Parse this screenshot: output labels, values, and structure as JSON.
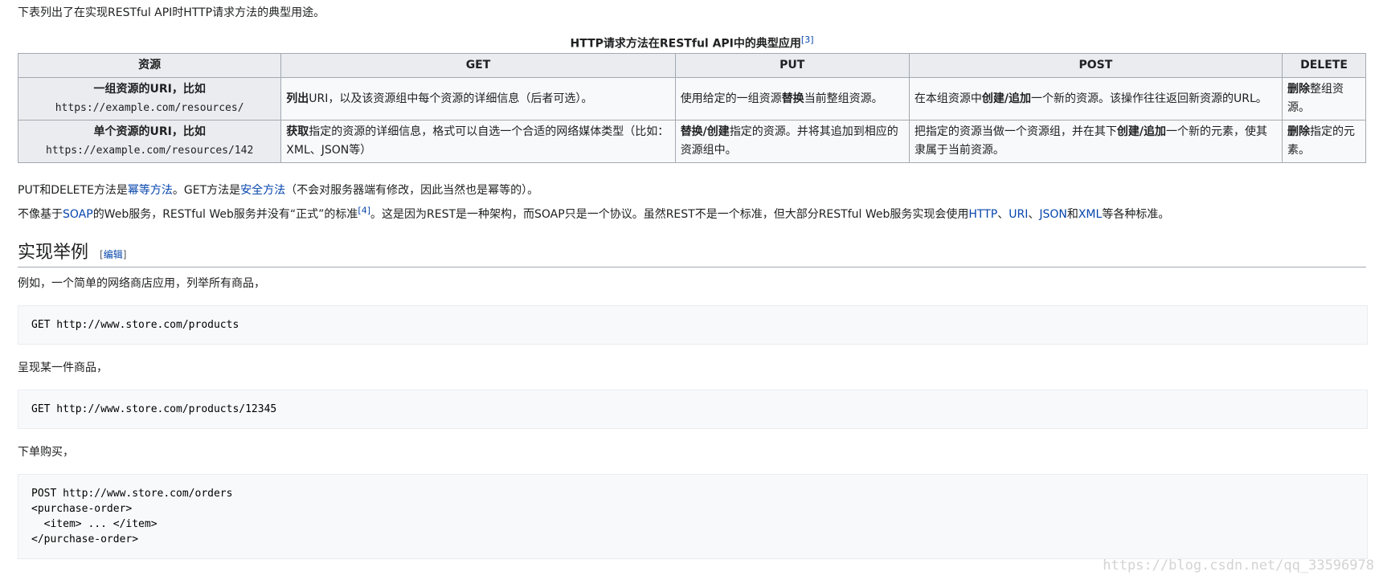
{
  "intro": "下表列出了在实现RESTful API时HTTP请求方法的典型用途。",
  "table": {
    "caption": "HTTP请求方法在RESTful API中的典型应用",
    "caption_ref": "[3]",
    "headers": [
      "资源",
      "GET",
      "PUT",
      "POST",
      "DELETE"
    ],
    "rows": [
      {
        "resource_label": "一组资源的URI，比如",
        "resource_uri": "https://example.com/resources/",
        "get": {
          "bold": "列出",
          "rest": "URI，以及该资源组中每个资源的详细信息（后者可选）。"
        },
        "put": {
          "pre": "使用给定的一组资源",
          "bold": "替换",
          "post": "当前整组资源。"
        },
        "post": {
          "pre": "在本组资源中",
          "bold": "创建/追加",
          "post": "一个新的资源。该操作往往返回新资源的URL。"
        },
        "delete": {
          "bold": "删除",
          "post": "整组资源。"
        }
      },
      {
        "resource_label": "单个资源的URI，比如",
        "resource_uri": "https://example.com/resources/142",
        "get": {
          "bold": "获取",
          "rest": "指定的资源的详细信息，格式可以自选一个合适的网络媒体类型（比如：XML、JSON等）"
        },
        "put": {
          "pre": "",
          "bold": "替换/创建",
          "post": "指定的资源。并将其追加到相应的资源组中。"
        },
        "post": {
          "pre": "把指定的资源当做一个资源组，并在其下",
          "bold": "创建/追加",
          "post": "一个新的元素，使其隶属于当前资源。"
        },
        "delete": {
          "bold": "删除",
          "post": "指定的元素。"
        }
      }
    ]
  },
  "para1": {
    "t1": "PUT和DELETE方法是",
    "link1": "幂等方法",
    "t2": "。GET方法是",
    "link2": "安全方法",
    "t3": "（不会对服务器端有修改，因此当然也是幂等的）。"
  },
  "para2": {
    "t1": "不像基于",
    "link_soap": "SOAP",
    "t2": "的Web服务，RESTful Web服务并没有“正式”的标准",
    "ref": "[4]",
    "t3": "。这是因为REST是一种架构，而SOAP只是一个协议。虽然REST不是一个标准，但大部分RESTful Web服务实现会使用",
    "link_http": "HTTP",
    "sep1": "、",
    "link_uri": "URI",
    "sep2": "、",
    "link_json": "JSON",
    "t4": "和",
    "link_xml": "XML",
    "t5": "等各种标准。"
  },
  "section": {
    "title": "实现举例",
    "edit_open": "[",
    "edit_label": "编辑",
    "edit_close": "]"
  },
  "examples": [
    {
      "text": "例如，一个简单的网络商店应用，列举所有商品，",
      "code": "GET http://www.store.com/products"
    },
    {
      "text": "呈现某一件商品，",
      "code": "GET http://www.store.com/products/12345"
    },
    {
      "text": "下单购买，",
      "code": "POST http://www.store.com/orders\n<purchase-order>\n  <item> ... </item>\n</purchase-order>"
    }
  ],
  "watermark": "https://blog.csdn.net/qq_33596978"
}
